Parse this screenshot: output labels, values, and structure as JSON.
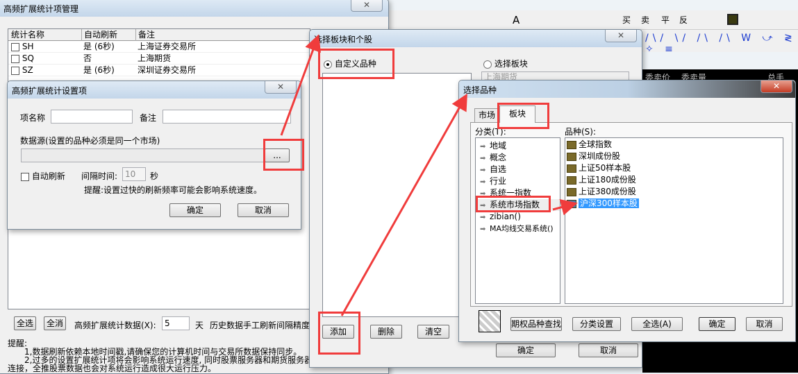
{
  "main_window": {
    "title": "高频扩展统计项管理",
    "columns": [
      "统计名称",
      "自动刷新",
      "备注"
    ],
    "rows": [
      {
        "name": "SH",
        "auto": "是 (6秒)",
        "note": "上海证券交易所"
      },
      {
        "name": "SQ",
        "auto": "否",
        "note": "上海期货"
      },
      {
        "name": "SZ",
        "auto": "是 (6秒)",
        "note": "深圳证券交易所"
      }
    ],
    "select_all": "全选",
    "deselect_all": "全消",
    "days_label": "高频扩展统计数据(X):",
    "days_value": "5",
    "days_unit": "天",
    "history_label": "历史数据手工刷新间隔精度",
    "reminder_title": "提醒:",
    "reminder_1": "1,数据刷新依赖本地时间戳,请确保您的计算机时间与交易所数据保持同步。",
    "reminder_2": "2,过多的设置扩展统计项将会影响系统运行速度, 同时股票服务器和期货服务器",
    "reminder_3": "连接，全推股票数据也会对系统运行造成很大运行压力。"
  },
  "settings_dialog": {
    "title": "高频扩展统计设置项",
    "name_label": "项名称",
    "note_label": "备注",
    "source_label": "数据源(设置的品种必须是同一个市场)",
    "browse": "...",
    "auto_refresh": "自动刷新",
    "interval_label": "间隔时间:",
    "interval_value": "10",
    "interval_unit": "秒",
    "tip": "提醒:设置过快的刷新频率可能会影响系统速度。",
    "ok": "确定",
    "cancel": "取消"
  },
  "block_dialog": {
    "title": "选择板块和个股",
    "custom_radio": "自定义品种",
    "block_radio": "选择板块",
    "block_combo": "上海期货",
    "add": "添加",
    "delete": "删除",
    "clear": "清空",
    "ok": "确定",
    "cancel": "取消"
  },
  "variety_dialog": {
    "title": "选择品种",
    "tabs": [
      "市场",
      "板块"
    ],
    "category_label": "分类(T):",
    "variety_label": "品种(S):",
    "categories": [
      "地域",
      "概念",
      "自选",
      "行业",
      "系统一指数",
      "系统市场指数",
      "zibian()",
      "MA均线交易系统()"
    ],
    "varieties": [
      "全球指数",
      "深圳成份股",
      "上证50样本股",
      "上证180成份股",
      "上证380成份股",
      "沪深300样本股"
    ],
    "buttons": [
      "期权品种查找",
      "分类设置",
      "全选(A)",
      "确定",
      "取消"
    ]
  },
  "background": {
    "toolbar_labels": [
      "A",
      "买",
      "卖",
      "平",
      "反"
    ],
    "quote_headers": [
      "委卖价",
      "委卖量",
      "总手"
    ]
  },
  "colors": {
    "annotation": "#f03c3c",
    "selection": "#3399ff"
  }
}
